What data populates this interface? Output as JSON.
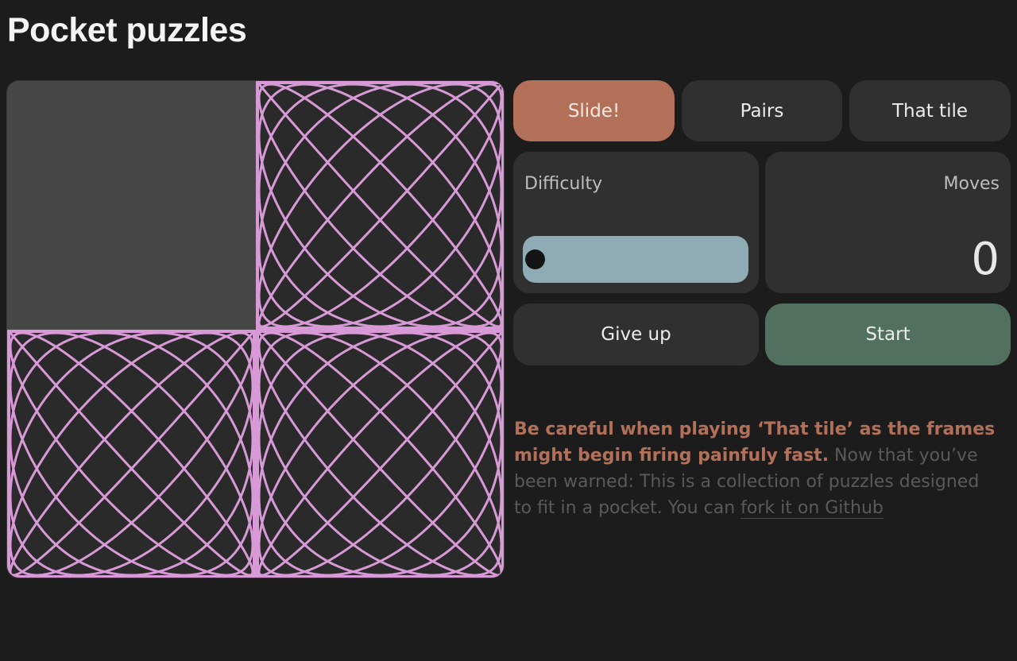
{
  "page": {
    "title": "Pocket puzzles"
  },
  "modes": [
    {
      "label": "Slide!",
      "active": true
    },
    {
      "label": "Pairs",
      "active": false
    },
    {
      "label": "That tile",
      "active": false
    }
  ],
  "difficulty": {
    "label": "Difficulty",
    "level": 0
  },
  "moves": {
    "label": "Moves",
    "value": "0"
  },
  "actions": {
    "give_up": "Give up",
    "start": "Start"
  },
  "info": {
    "warning": "Be careful when playing ‘That tile’ as the frames might begin firing painfuly fast.",
    "text": " Now that you’ve been warned: This is a collection of puzzles designed to fit in a pocket. You can ",
    "link": "fork it on Github"
  },
  "colors": {
    "background": "#1c1c1c",
    "active_mode": "#b37059",
    "start": "#527060",
    "slider": "#8fabb6",
    "pattern": "#d79ad6",
    "empty_tile": "#474747"
  },
  "board": {
    "grid": "2x2",
    "tiles": [
      {
        "state": "empty",
        "icon": "empty-slot"
      },
      {
        "state": "filled",
        "icon": "lissajous-pattern"
      },
      {
        "state": "filled",
        "icon": "lissajous-pattern"
      },
      {
        "state": "filled",
        "icon": "lissajous-pattern"
      }
    ]
  }
}
